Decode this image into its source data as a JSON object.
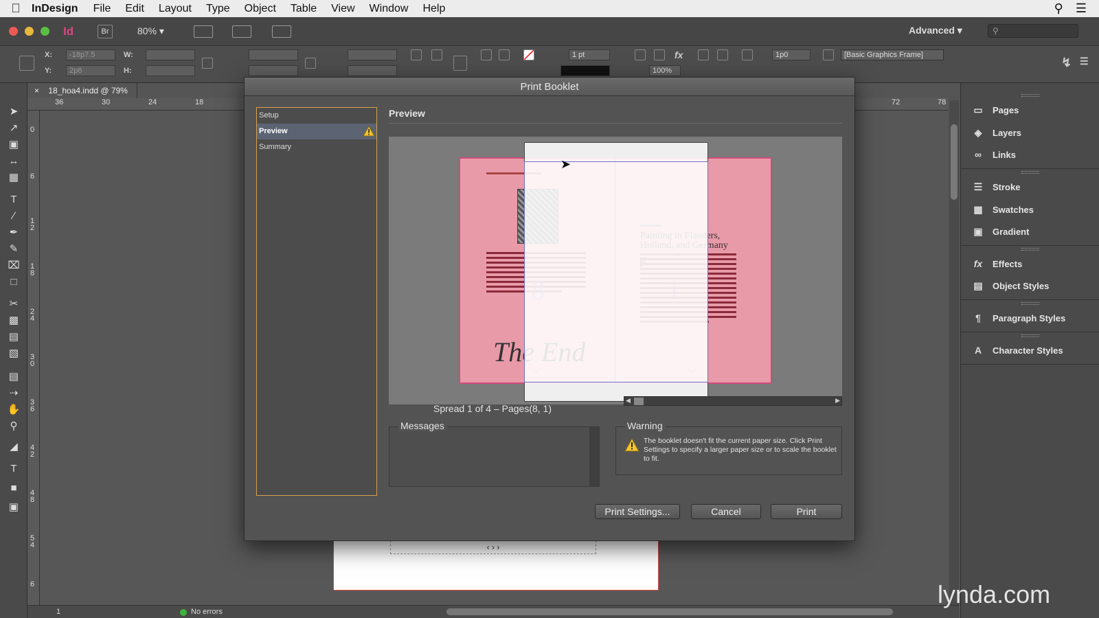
{
  "menubar": {
    "app_name": "InDesign",
    "items": [
      "File",
      "Edit",
      "Layout",
      "Type",
      "Object",
      "Table",
      "View",
      "Window",
      "Help"
    ]
  },
  "appbar": {
    "logo": "Id",
    "bridge": "Br",
    "zoom": "80%",
    "workspace": "Advanced"
  },
  "controlpanel": {
    "x_label": "X:",
    "y_label": "Y:",
    "w_label": "W:",
    "h_label": "H:",
    "x_value": "-18p7.5",
    "y_value": "2p6",
    "stroke_weight": "1 pt",
    "opacity": "100%",
    "gap": "1p0",
    "frame_style": "[Basic Graphics Frame]"
  },
  "document": {
    "tab_title": "18_hoa4.indd @ 79%",
    "frame_text": "‹ › ›"
  },
  "rulers": {
    "h_ticks_left": [
      "36",
      "30",
      "24",
      "18"
    ],
    "h_ticks_right": [
      "72",
      "78"
    ],
    "v_ticks": [
      "0",
      "6",
      "1 2",
      "1 8",
      "2 4",
      "3 0",
      "3 6",
      "4 2",
      "4 8",
      "5 4",
      "6"
    ]
  },
  "status": {
    "page": "1",
    "errors": "No errors"
  },
  "panels": {
    "items": [
      "Pages",
      "Layers",
      "Links",
      "Stroke",
      "Swatches",
      "Gradient",
      "Effects",
      "Object Styles",
      "Paragraph Styles",
      "Character Styles"
    ]
  },
  "dialog": {
    "title": "Print Booklet",
    "nav": [
      "Setup",
      "Preview",
      "Summary"
    ],
    "preview_heading": "Preview",
    "spread_info": "Spread 1 of 4 – Pages(8, 1)",
    "messages_label": "Messages",
    "warning_label": "Warning",
    "warning_text": "The booklet doesn't fit the current paper size. Click Print Settings to specify a larger paper size or to scale the booklet to fit.",
    "buttons": {
      "print_settings": "Print Settings...",
      "cancel": "Cancel",
      "print": "Print"
    },
    "preview": {
      "left_page_number": "8",
      "right_page_number": "1",
      "left_heading": "The End",
      "right_title": "Painting in Flanders, Holland, and Germany",
      "drop_cap": "F"
    }
  },
  "watermark": "lynda.com",
  "colors": {
    "spread_fill": "#e89aa8",
    "bleed_border": "#d34a7c",
    "nav_highlight": "#d6a34c",
    "status_ok": "#3cb43c"
  }
}
